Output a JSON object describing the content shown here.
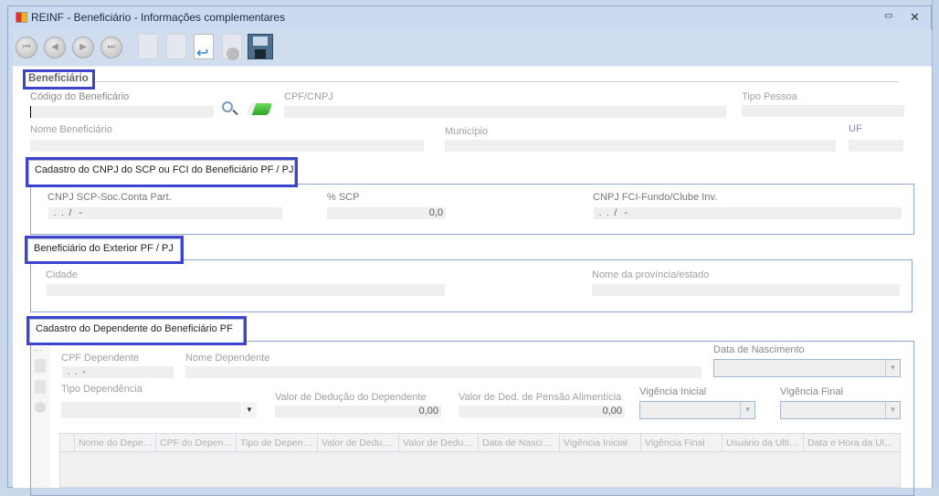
{
  "window": {
    "title": "REINF - Beneficiário - Informações complementares",
    "minimize": "▭",
    "close": "✕"
  },
  "beneficiario": {
    "section": "Beneficiário",
    "codigo_label": "Código do Beneficário",
    "codigo_value": "",
    "cpf_label": "CPF/CNPJ",
    "tipo_label": "Tipo Pessoa",
    "nome_label": "Nome Beneficiário",
    "municipio_label": "Município",
    "uf_label": "UF"
  },
  "scp": {
    "section": "Cadastro do CNPJ do SCP ou FCI do Beneficiário PF / PJ",
    "cnpj_scp_label": "CNPJ SCP-Soc.Conta Part.",
    "cnpj_scp_value": " .  .  /   -",
    "pct_label": "% SCP",
    "pct_value": "0,0",
    "cnpj_fci_label": "CNPJ FCI-Fundo/Clube Inv.",
    "cnpj_fci_value": " .  .  /   -"
  },
  "exterior": {
    "section": "Beneficiário do Exterior PF / PJ",
    "cidade_label": "Cidade",
    "provincia_label": "Nome da província/estado"
  },
  "dependente": {
    "section": "Cadastro do Dependente do Beneficiário PF",
    "cpf_label": "CPF Dependente",
    "cpf_value": " .  .  -",
    "nome_label": "Nome Dependente",
    "nasc_label": "Data de Nascimento",
    "tipo_label": "Tipo Dependência",
    "valor_ded_label": "Valor de Dedução do Dependente",
    "valor_ded_value": "0,00",
    "valor_pensao_label": "Valor de Ded. de Pensão Alimentícia",
    "valor_pensao_value": "0,00",
    "vig_ini_label": "Vigência Inicial",
    "vig_fin_label": "Vigência Final",
    "columns": [
      "Nome do Depe…",
      "CPF do Depen…",
      "Tipo de Depen…",
      "Valor de Dedu…",
      "Valor de Dedu…",
      "Data de Nasci…",
      "Vigência Inicial",
      "Vigência Final",
      "Usuário da Ulti…",
      "Data e Hora da Ul…"
    ]
  },
  "colors": {
    "highlight": "#3b44cc",
    "field": "#efefef"
  }
}
